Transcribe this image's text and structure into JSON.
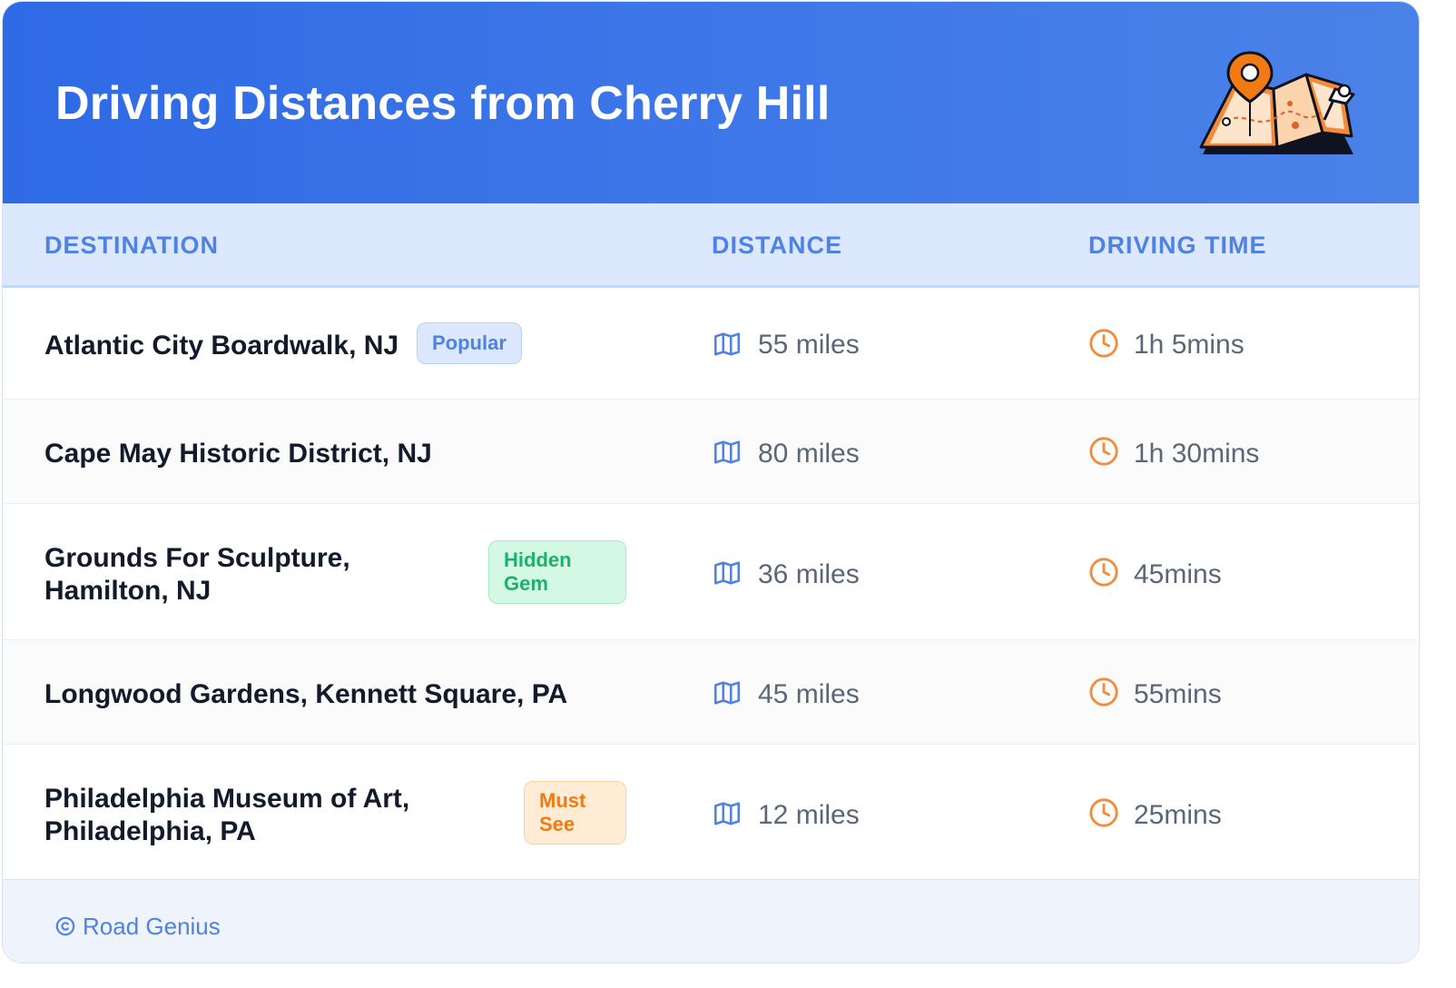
{
  "header": {
    "title": "Driving Distances from Cherry Hill"
  },
  "columns": {
    "destination": "DESTINATION",
    "distance": "DISTANCE",
    "driving_time": "DRIVING TIME"
  },
  "rows": [
    {
      "line1": "Atlantic City Boardwalk, NJ",
      "line2": "",
      "badge": "Popular",
      "badge_line2": "",
      "distance": "55 miles",
      "time": "1h 5mins"
    },
    {
      "line1": "Cape May Historic District, NJ",
      "line2": "",
      "badge": "",
      "badge_line2": "",
      "distance": "80 miles",
      "time": "1h 30mins"
    },
    {
      "line1": "Grounds For Sculpture,",
      "line2": "Hamilton, NJ",
      "badge": "Hidden",
      "badge_line2": "Gem",
      "distance": "36 miles",
      "time": "45mins"
    },
    {
      "line1": "Longwood Gardens, Kennett Square, PA",
      "line2": "",
      "badge": "",
      "badge_line2": "",
      "distance": "45 miles",
      "time": "55mins"
    },
    {
      "line1": "Philadelphia Museum of Art,",
      "line2": "Philadelphia, PA",
      "badge": "Must",
      "badge_line2": "See",
      "distance": "12 miles",
      "time": "25mins"
    }
  ],
  "footer": {
    "text": "Road Genius"
  },
  "icons": {
    "map": "map-icon",
    "clock": "clock-icon",
    "copyright": "copyright-icon",
    "header_illustration": "map-pin-illustration-icon"
  },
  "colors": {
    "header_blue": "#2f6ae6",
    "accent_blue": "#4f82e2",
    "orange": "#f27a14",
    "green": "#1db169",
    "text_dark": "#131a2b",
    "text_muted": "#5b6677"
  }
}
